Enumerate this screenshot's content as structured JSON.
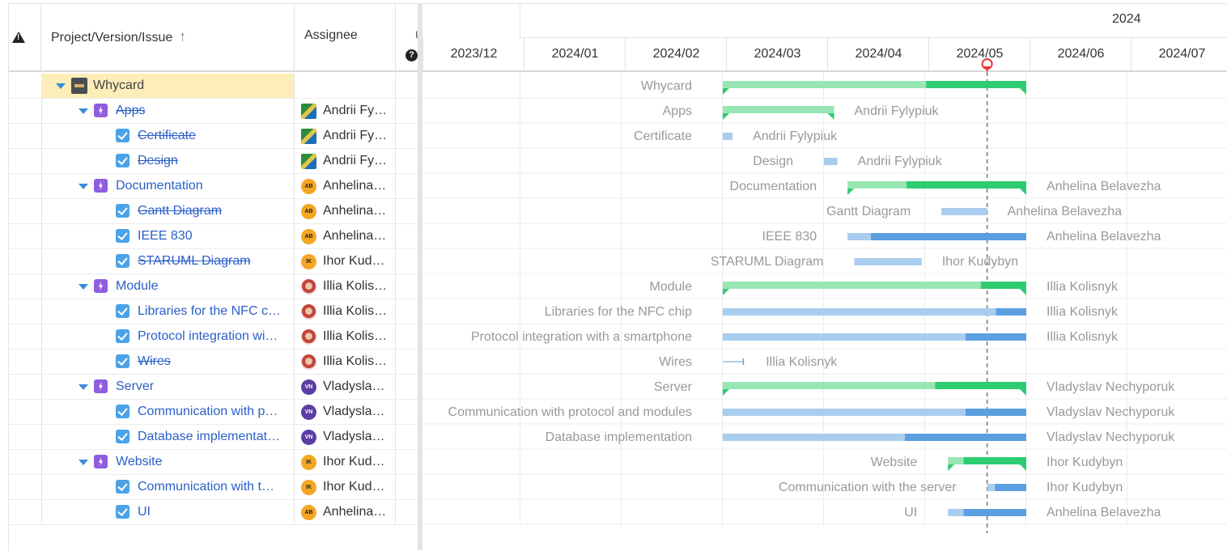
{
  "columns": {
    "name": "Project/Version/Issue",
    "sort_icon": "arrow-up-icon",
    "assignee": "Assignee",
    "u": "U",
    "warning_icon": "warning-icon",
    "help_icon": "help-icon"
  },
  "timeline": {
    "year": "2024",
    "months": [
      "2023/12",
      "2024/01",
      "2024/02",
      "2024/03",
      "2024/04",
      "2024/05",
      "2024/06",
      "2024/07"
    ]
  },
  "rows": [
    {
      "name": "Whycard",
      "type": "project",
      "assignee": "",
      "strike": false
    },
    {
      "name": "Apps",
      "type": "epic",
      "assignee": "Andrii Fy…",
      "avatar": "img1",
      "strike": true
    },
    {
      "name": "Certificate",
      "type": "task",
      "assignee": "Andrii Fy…",
      "avatar": "img1",
      "strike": true
    },
    {
      "name": "Design",
      "type": "task",
      "assignee": "Andrii Fy…",
      "avatar": "img1",
      "strike": true
    },
    {
      "name": "Documentation",
      "type": "epic",
      "assignee": "Anhelina…",
      "avatar": "AB",
      "strike": false
    },
    {
      "name": "Gantt Diagram",
      "type": "task",
      "assignee": "Anhelina…",
      "avatar": "AB",
      "strike": true
    },
    {
      "name": "IEEE 830",
      "type": "task",
      "assignee": "Anhelina…",
      "avatar": "AB",
      "strike": false
    },
    {
      "name": "STARUML Diagram",
      "type": "task",
      "assignee": "Ihor Kud…",
      "avatar": "IK",
      "strike": true
    },
    {
      "name": "Module",
      "type": "epic",
      "assignee": "Illia Kolis…",
      "avatar": "img2",
      "strike": false
    },
    {
      "name": "Libraries for the NFC c…",
      "type": "task",
      "assignee": "Illia Kolis…",
      "avatar": "img2",
      "strike": false
    },
    {
      "name": "Protocol integration wi…",
      "type": "task",
      "assignee": "Illia Kolis…",
      "avatar": "img2",
      "strike": false
    },
    {
      "name": "Wires",
      "type": "task",
      "assignee": "Illia Kolis…",
      "avatar": "img2",
      "strike": true
    },
    {
      "name": "Server",
      "type": "epic",
      "assignee": "Vladysla…",
      "avatar": "VN",
      "strike": false
    },
    {
      "name": "Communication with p…",
      "type": "task",
      "assignee": "Vladysla…",
      "avatar": "VN",
      "strike": false
    },
    {
      "name": "Database implementat…",
      "type": "task",
      "assignee": "Vladysla…",
      "avatar": "VN",
      "strike": false
    },
    {
      "name": "Website",
      "type": "epic",
      "assignee": "Ihor Kud…",
      "avatar": "IK",
      "strike": false
    },
    {
      "name": "Communication with t…",
      "type": "task",
      "assignee": "Ihor Kud…",
      "avatar": "IK",
      "strike": false
    },
    {
      "name": "UI",
      "type": "task",
      "assignee": "Anhelina…",
      "avatar": "AB",
      "strike": false
    }
  ],
  "gantt": [
    {
      "label": "Whycard",
      "assignee": "",
      "kind": "epic",
      "start": "2024-03-01",
      "end": "2024-06-01",
      "progress": 0.67
    },
    {
      "label": "Apps",
      "assignee": "Andrii Fylypiuk",
      "kind": "epic",
      "start": "2024-03-01",
      "end": "2024-04-04",
      "progress": 1.0
    },
    {
      "label": "Certificate",
      "assignee": "Andrii Fylypiuk",
      "kind": "task",
      "start": "2024-03-01",
      "end": "2024-03-04",
      "progress": 1.0
    },
    {
      "label": "Design",
      "assignee": "Andrii Fylypiuk",
      "kind": "task",
      "start": "2024-04-01",
      "end": "2024-04-05",
      "progress": 1.0
    },
    {
      "label": "Documentation",
      "assignee": "Anhelina Belavezha",
      "kind": "epic",
      "start": "2024-04-08",
      "end": "2024-06-01",
      "progress": 0.33
    },
    {
      "label": "Gantt Diagram",
      "assignee": "Anhelina Belavezha",
      "kind": "task",
      "start": "2024-05-06",
      "end": "2024-05-20",
      "progress": 1.0
    },
    {
      "label": "IEEE 830",
      "assignee": "Anhelina Belavezha",
      "kind": "task",
      "start": "2024-04-08",
      "end": "2024-06-01",
      "progress": 0.13
    },
    {
      "label": "STARUML Diagram",
      "assignee": "Ihor Kudybyn",
      "kind": "task",
      "start": "2024-04-10",
      "end": "2024-04-30",
      "progress": 1.0
    },
    {
      "label": "Module",
      "assignee": "Illia Kolisnyk",
      "kind": "epic",
      "start": "2024-03-01",
      "end": "2024-06-01",
      "progress": 0.85
    },
    {
      "label": "Libraries for the NFC chip",
      "assignee": "Illia Kolisnyk",
      "kind": "task",
      "start": "2024-03-01",
      "end": "2024-06-01",
      "progress": 0.9
    },
    {
      "label": "Protocol integration with a smartphone",
      "assignee": "Illia Kolisnyk",
      "kind": "task",
      "start": "2024-03-01",
      "end": "2024-06-01",
      "progress": 0.8
    },
    {
      "label": "Wires",
      "assignee": "Illia Kolisnyk",
      "kind": "milestone",
      "start": "2024-03-01",
      "end": "2024-03-08",
      "progress": 1.0
    },
    {
      "label": "Server",
      "assignee": "Vladyslav Nechyporuk",
      "kind": "epic",
      "start": "2024-03-01",
      "end": "2024-06-01",
      "progress": 0.7
    },
    {
      "label": "Communication with protocol and modules",
      "assignee": "Vladyslav Nechyporuk",
      "kind": "task",
      "start": "2024-03-01",
      "end": "2024-06-01",
      "progress": 0.8
    },
    {
      "label": "Database implementation",
      "assignee": "Vladyslav Nechyporuk",
      "kind": "task",
      "start": "2024-03-01",
      "end": "2024-06-01",
      "progress": 0.6
    },
    {
      "label": "Website",
      "assignee": "Ihor Kudybyn",
      "kind": "epic",
      "start": "2024-05-08",
      "end": "2024-06-01",
      "progress": 0.2
    },
    {
      "label": "Communication with the server",
      "assignee": "Ihor Kudybyn",
      "kind": "task",
      "start": "2024-05-20",
      "end": "2024-06-01",
      "progress": 0.2
    },
    {
      "label": "UI",
      "assignee": "Anhelina Belavezha",
      "kind": "task",
      "start": "2024-05-08",
      "end": "2024-06-01",
      "progress": 0.2
    }
  ],
  "today": "2024-05-20",
  "colors": {
    "epic_done": "#2ecc71",
    "epic_todo": "#98e6b4",
    "task_done": "#5b9fe0",
    "task_todo": "#a9cdee",
    "label": "#999999",
    "today": "#777777",
    "marker": "#e53935"
  }
}
